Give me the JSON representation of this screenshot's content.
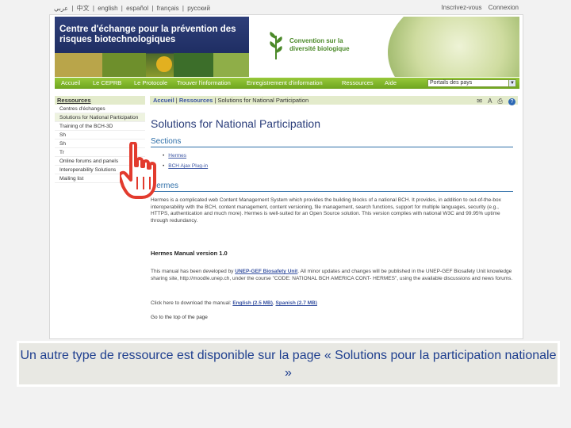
{
  "top_bar": {
    "languages": [
      "عربي",
      "中文",
      "english",
      "español",
      "français",
      "русский"
    ],
    "separator": "|",
    "register": "Inscrivez-vous",
    "login": "Connexion"
  },
  "banner": {
    "title": "Centre d'échange pour la prévention des risques biotechnologiques",
    "cbd_name": "Convention sur la diversité biologique"
  },
  "menu": {
    "items": [
      "Accueil",
      "Le CEPRB",
      "Le Protocole",
      "Trouver l'information",
      "Enregistrement d'information",
      "Ressources",
      "Aide"
    ],
    "jump_value": "Portails des pays"
  },
  "sidebar": {
    "header": "Ressources",
    "items": [
      "Centres d'échanges",
      "Solutions for National Participation",
      "Training of the BCH-3D",
      "Sh",
      "Sh",
      "Tr",
      "Online forums and panels",
      "Interoperability Solutions",
      "Mailing list"
    ]
  },
  "content": {
    "breadcrumb_home": "Accueil",
    "breadcrumb_sep": "|",
    "breadcrumb_section": "Ressources",
    "breadcrumb_current": "Solutions for National Participation",
    "page_title": "Solutions for National Participation",
    "sections_heading": "Sections",
    "sections_links": [
      "Hermes",
      "BCH Ajax Plug-in"
    ],
    "hermes_heading": "Hermes",
    "hermes_text": "Hermes is a complicated web Content Management System which provides the building blocks of a national BCH. It provides, in addition to out-of-the-box interoperability with the BCH, content management, content versioning, file management, search functions, support for multiple languages, security (e.g., HTTPS, authentication and much more). Hermes is well-suited for an Open Source solution. This version complies with national W3C and 99.95% uptime through redundancy.",
    "manual_heading": "Hermes Manual version 1.0",
    "manual_text_1": "This manual has been developed by",
    "manual_link": "UNEP-GEF Biosafety Unit",
    "manual_text_2": ". All minor updates and changes will be published in the UNEP-GEF Biosafety Unit knowledge sharing site, http://moodle.unep.ch, under the course \"CODE: NATIONAL BCH AMERICA CONT- HERMES\", using the available discussions and news forums.",
    "download_text": "Click here to download the manual:",
    "download_english": "English (2.5 MB)",
    "download_spanish": "Spanish (2.7 MB)",
    "top_link": "Go to the top of the page"
  },
  "caption": "Un autre type de ressource est disponible sur la page « Solutions pour la participation nationale »",
  "colors": {
    "menu_green": "#6ea51e",
    "heading_blue": "#2f6fa8",
    "caption_blue": "#1f3f8f"
  }
}
